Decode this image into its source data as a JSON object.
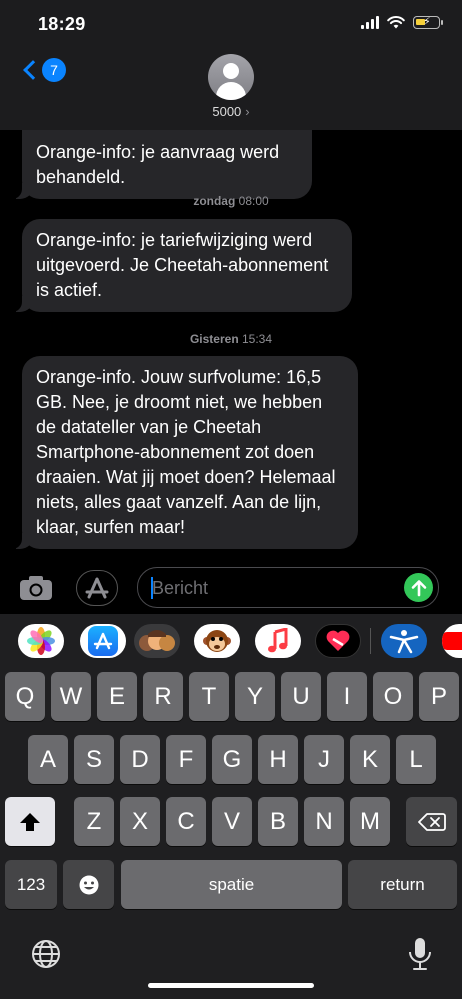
{
  "status": {
    "time": "18:29"
  },
  "header": {
    "back_count": "7",
    "contact_name": "5000",
    "contact_chevron": "›"
  },
  "messages": {
    "partial_bubble": "Orange-info: je aanvraag werd\nbehandeld.",
    "timestamp1": {
      "day": "zondag",
      "time": "08:00"
    },
    "bubble2": "Orange-info: je tariefwijziging werd uitgevoerd. Je Cheetah-abonnement is actief.",
    "timestamp2": {
      "day": "Gisteren",
      "time": "15:34"
    },
    "bubble3": "Orange-info. Jouw surfvolume: 16,5 GB. Nee, je droomt niet, we hebben de datateller van je Cheetah Smartphone-abonnement zot doen draaien. Wat jij moet doen? Helemaal niets, alles gaat vanzelf. Aan de lijn, klaar, surfen maar!"
  },
  "input": {
    "placeholder": "Bericht"
  },
  "app_strip": [
    "photos-icon",
    "appstore-icon",
    "memoji-icon",
    "monkey-animoji-icon",
    "music-icon",
    "heart-sticker-icon",
    "fitness-app-icon",
    "youtube-icon"
  ],
  "keyboard": {
    "row1": [
      "Q",
      "W",
      "E",
      "R",
      "T",
      "Y",
      "U",
      "I",
      "O",
      "P"
    ],
    "row2": [
      "A",
      "S",
      "D",
      "F",
      "G",
      "H",
      "J",
      "K",
      "L"
    ],
    "row3": [
      "Z",
      "X",
      "C",
      "V",
      "B",
      "N",
      "M"
    ],
    "numbers_label": "123",
    "space_label": "spatie",
    "return_label": "return"
  },
  "colors": {
    "accent": "#0a84ff",
    "send": "#33c759",
    "bubble": "#262629"
  }
}
